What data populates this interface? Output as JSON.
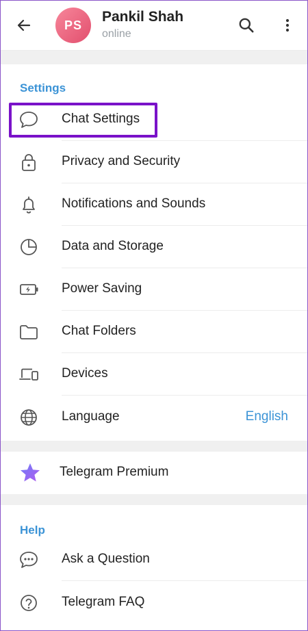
{
  "header": {
    "avatar_initials": "PS",
    "user_name": "Pankil Shah",
    "status": "online"
  },
  "settings_section": {
    "title": "Settings",
    "items": [
      {
        "label": "Chat Settings",
        "icon": "chat-bubble-icon"
      },
      {
        "label": "Privacy and Security",
        "icon": "lock-icon"
      },
      {
        "label": "Notifications and Sounds",
        "icon": "bell-icon"
      },
      {
        "label": "Data and Storage",
        "icon": "pie-chart-icon"
      },
      {
        "label": "Power Saving",
        "icon": "battery-icon"
      },
      {
        "label": "Chat Folders",
        "icon": "folder-icon"
      },
      {
        "label": "Devices",
        "icon": "devices-icon"
      },
      {
        "label": "Language",
        "icon": "globe-icon",
        "value": "English"
      }
    ]
  },
  "premium": {
    "label": "Telegram Premium",
    "icon": "star-icon"
  },
  "help_section": {
    "title": "Help",
    "items": [
      {
        "label": "Ask a Question",
        "icon": "chat-dots-icon"
      },
      {
        "label": "Telegram FAQ",
        "icon": "question-icon"
      }
    ]
  },
  "colors": {
    "accent": "#3b93d6",
    "highlight_border": "#7a12c9",
    "premium_star": "#8b5cf6"
  }
}
